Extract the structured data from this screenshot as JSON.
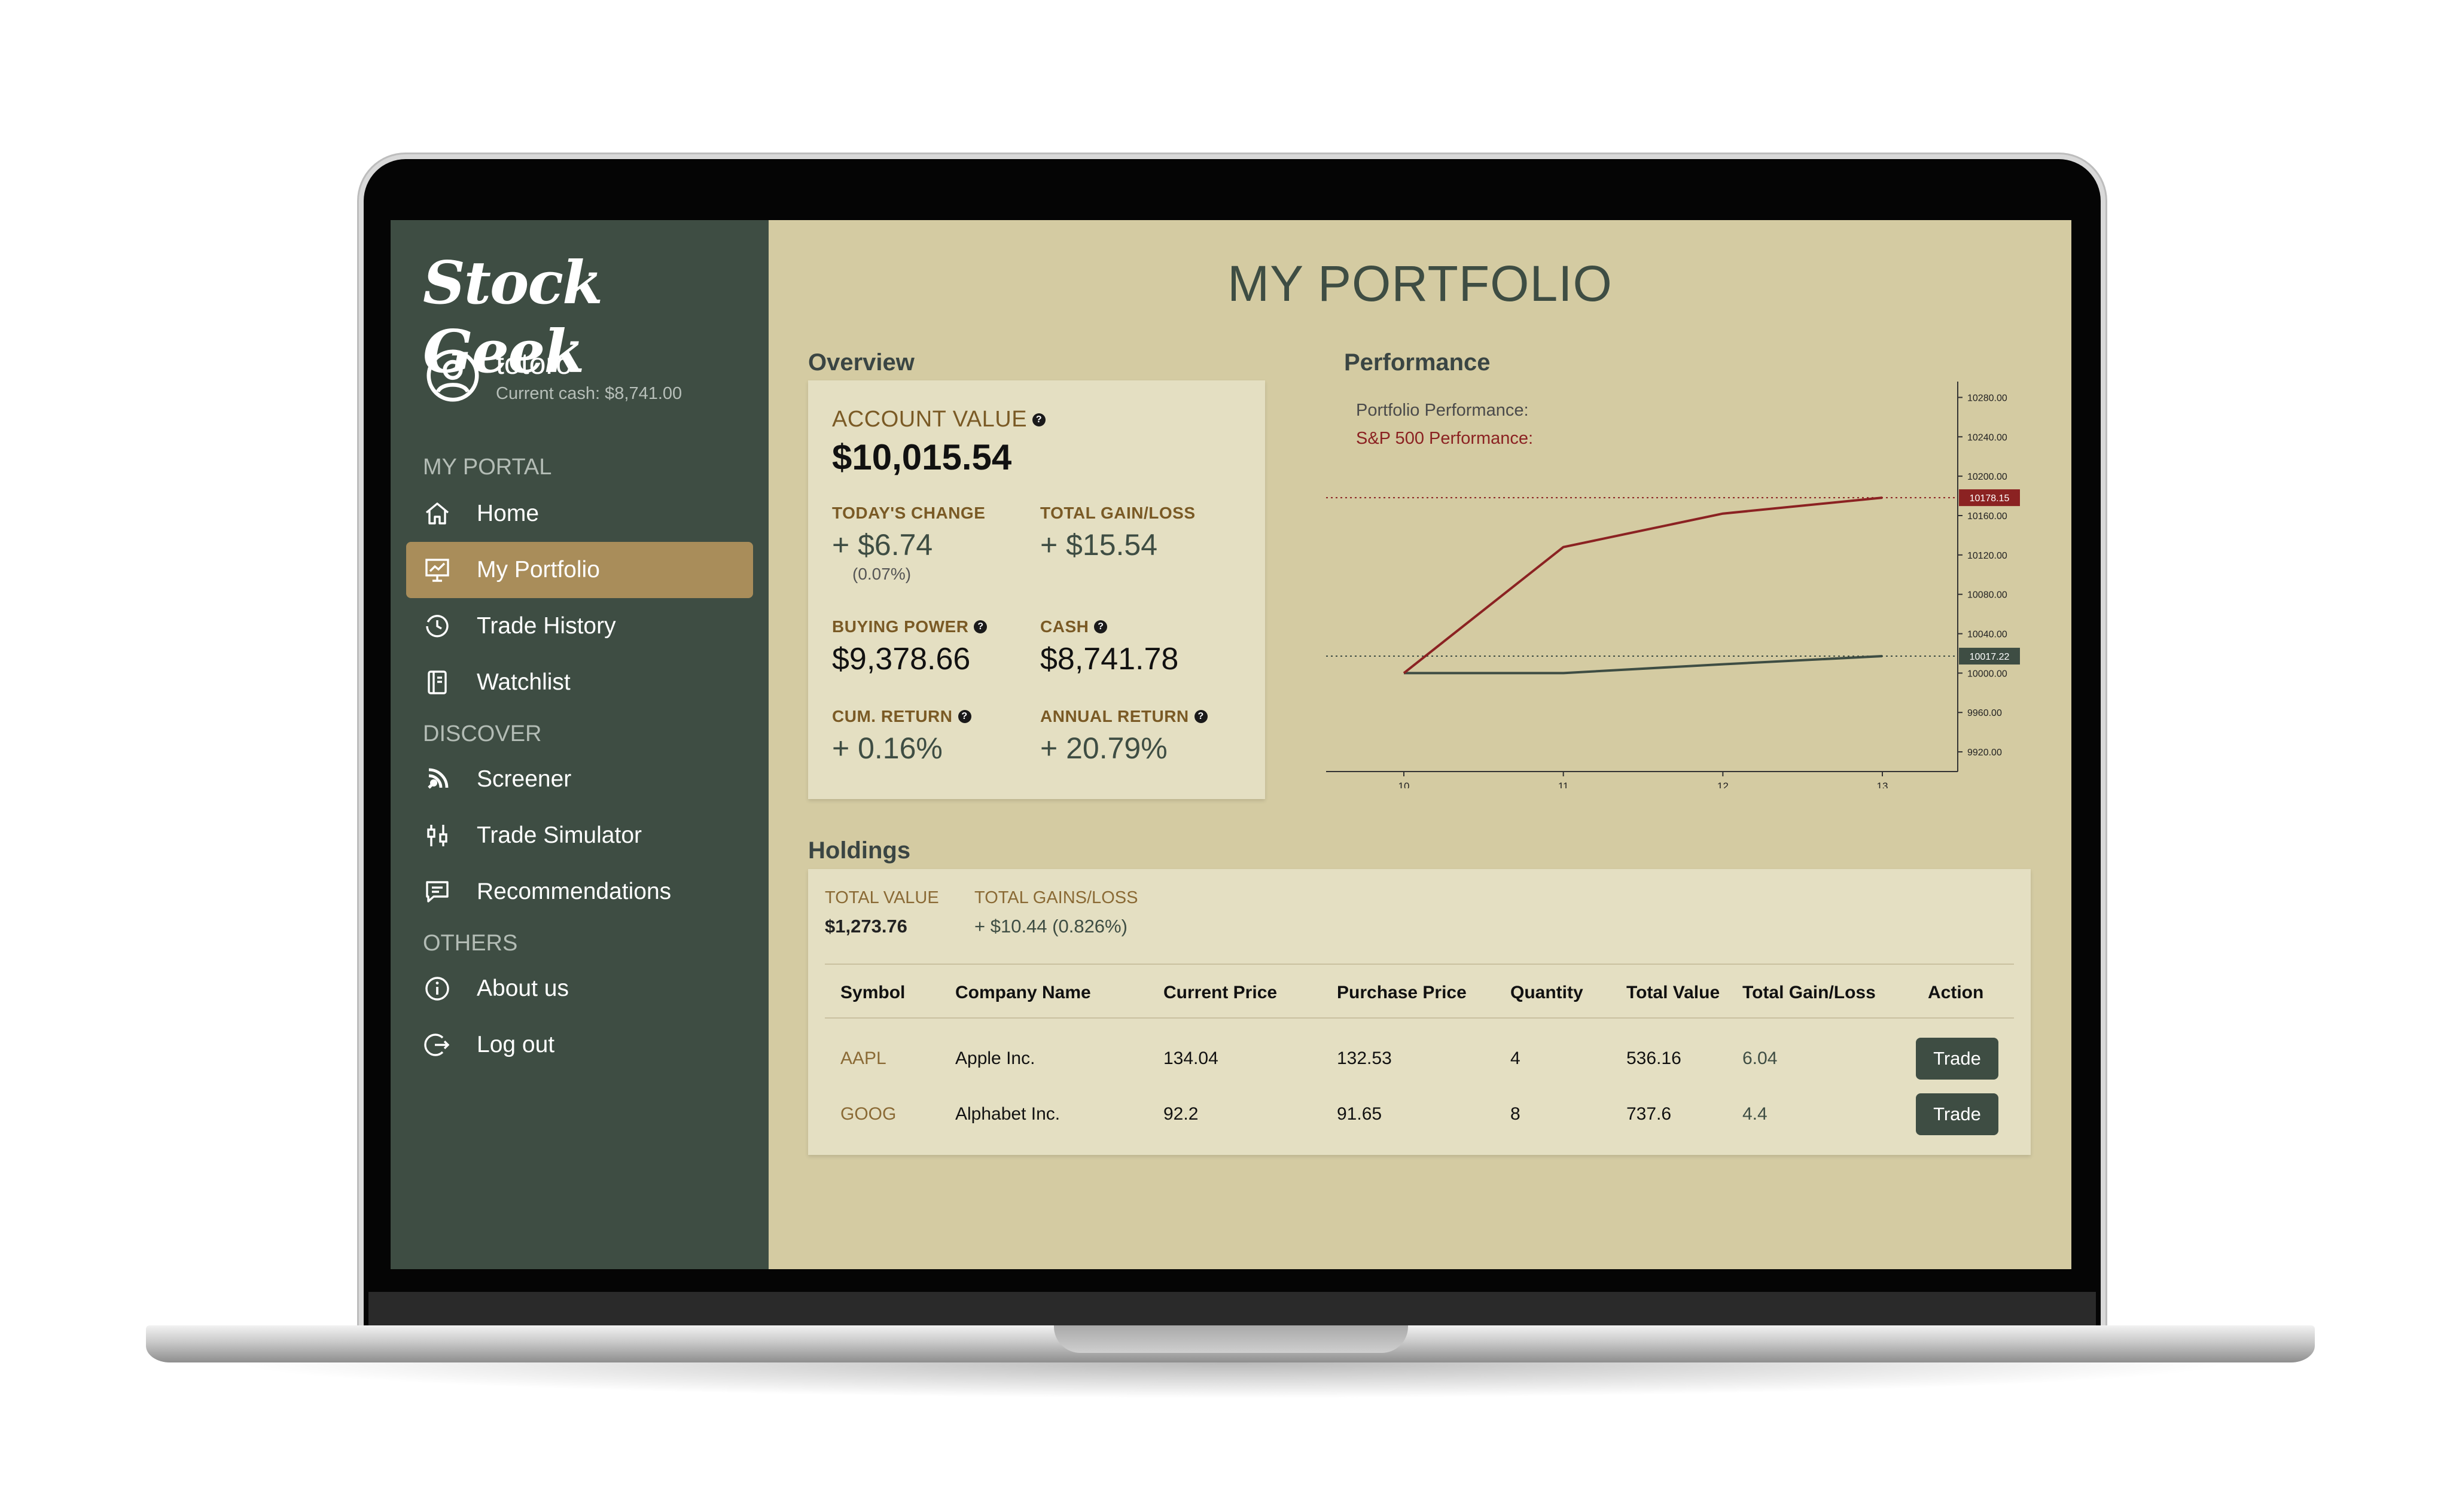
{
  "app": {
    "logo": "Stock Geek"
  },
  "user": {
    "name": "totoro",
    "cash": "Current cash: $8,741.00"
  },
  "sidebar": {
    "sections": [
      "MY PORTAL",
      "DISCOVER",
      "OTHERS"
    ],
    "items": [
      {
        "label": "Home",
        "icon": "home-icon"
      },
      {
        "label": "My Portfolio",
        "icon": "presentation-chart-icon",
        "active": true
      },
      {
        "label": "Trade History",
        "icon": "clock-history-icon"
      },
      {
        "label": "Watchlist",
        "icon": "notebook-icon"
      },
      {
        "label": "Screener",
        "icon": "screener-icon"
      },
      {
        "label": "Trade Simulator",
        "icon": "candlestick-icon"
      },
      {
        "label": "Recommendations",
        "icon": "message-icon"
      },
      {
        "label": "About us",
        "icon": "info-icon"
      },
      {
        "label": "Log out",
        "icon": "logout-icon"
      }
    ]
  },
  "main": {
    "title": "MY PORTFOLIO",
    "overview": {
      "heading": "Overview",
      "account_value_label": "ACCOUNT VALUE",
      "account_value": "$10,015.54",
      "todays_change_label": "TODAY'S CHANGE",
      "todays_change": "+ $6.74",
      "todays_change_pct": "(0.07%)",
      "total_gain_label": "TOTAL GAIN/LOSS",
      "total_gain": "+ $15.54",
      "buying_power_label": "BUYING POWER",
      "buying_power": "$9,378.66",
      "cash_label": "CASH",
      "cash": "$8,741.78",
      "cum_return_label": "CUM. RETURN",
      "cum_return": "+ 0.16%",
      "annual_return_label": "ANNUAL RETURN",
      "annual_return": "+ 20.79%",
      "help_glyph": "?"
    },
    "performance": {
      "heading": "Performance",
      "legend_portfolio": "Portfolio Performance:",
      "legend_sp500": "S&P 500 Performance:"
    },
    "holdings": {
      "heading": "Holdings",
      "total_value_label": "TOTAL VALUE",
      "total_value": "$1,273.76",
      "total_gains_label": "TOTAL GAINS/LOSS",
      "total_gains": "+ $10.44 (0.826%)",
      "columns": [
        "Symbol",
        "Company Name",
        "Current Price",
        "Purchase Price",
        "Quantity",
        "Total Value",
        "Total Gain/Loss",
        "Action"
      ],
      "rows": [
        {
          "symbol": "AAPL",
          "company": "Apple Inc.",
          "current": "134.04",
          "purchase": "132.53",
          "quantity": "4",
          "total": "536.16",
          "gain": "6.04",
          "action": "Trade"
        },
        {
          "symbol": "GOOG",
          "company": "Alphabet Inc.",
          "current": "92.2",
          "purchase": "91.65",
          "quantity": "8",
          "total": "737.6",
          "gain": "4.4",
          "action": "Trade"
        }
      ]
    }
  },
  "colors": {
    "sidebar": "#3e4d43",
    "main_bg": "#d4cba2",
    "card_bg": "#e4dfc2",
    "active_nav": "#a98d5a",
    "portfolio_line": "#3e4d43",
    "sp500_line": "#8b2222"
  },
  "chart_data": {
    "type": "line",
    "x": [
      10,
      11,
      12,
      13
    ],
    "series": [
      {
        "name": "Portfolio Performance",
        "values": [
          10000.0,
          10000.0,
          10009.0,
          10017.22
        ],
        "color": "#3e4d43",
        "last_label": "10017.22"
      },
      {
        "name": "S&P 500 Performance",
        "values": [
          10000.0,
          10128.0,
          10162.0,
          10178.15
        ],
        "color": "#8b2222",
        "last_label": "10178.15"
      }
    ],
    "xticks": [
      "10",
      "11",
      "12",
      "13"
    ],
    "yticks": [
      "10280.00",
      "10240.00",
      "10200.00",
      "10160.00",
      "10120.00",
      "10080.00",
      "10040.00",
      "10000.00",
      "9960.00",
      "9920.00"
    ],
    "ylim": [
      9900,
      10290
    ],
    "y_axis_side": "right",
    "grid": false
  }
}
